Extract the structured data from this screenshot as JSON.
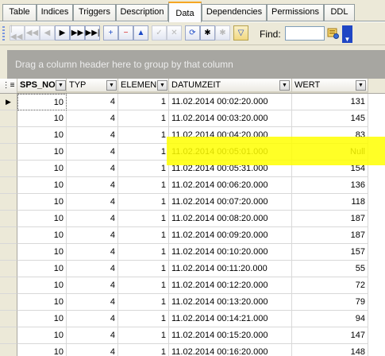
{
  "tabs": [
    {
      "label": "Table"
    },
    {
      "label": "Indices"
    },
    {
      "label": "Triggers"
    },
    {
      "label": "Description"
    },
    {
      "label": "Data"
    },
    {
      "label": "Dependencies"
    },
    {
      "label": "Permissions"
    },
    {
      "label": "DDL"
    }
  ],
  "active_tab": "Data",
  "toolbar": {
    "buttons": [
      {
        "name": "first-record-button",
        "glyph": "|◀◀",
        "state": "disabled"
      },
      {
        "name": "prior-page-button",
        "glyph": "◀◀",
        "state": "disabled"
      },
      {
        "name": "prior-record-button",
        "glyph": "◀",
        "state": "disabled"
      },
      {
        "name": "next-record-button",
        "glyph": "▶",
        "state": "enabled"
      },
      {
        "name": "next-page-button",
        "glyph": "▶▶",
        "state": "enabled"
      },
      {
        "name": "last-record-button",
        "glyph": "▶▶|",
        "state": "enabled"
      },
      {
        "name": "insert-record-button",
        "glyph": "+",
        "state": "enabled"
      },
      {
        "name": "delete-record-button",
        "glyph": "−",
        "state": "enabled"
      },
      {
        "name": "edit-record-button",
        "glyph": "▲",
        "state": "enabled"
      },
      {
        "name": "post-edit-button",
        "glyph": "✓",
        "state": "disabled"
      },
      {
        "name": "cancel-edit-button",
        "glyph": "✕",
        "state": "disabled"
      },
      {
        "name": "refresh-button",
        "glyph": "⟳",
        "state": "enabled"
      },
      {
        "name": "bookmark-button",
        "glyph": "✱",
        "state": "enabled"
      },
      {
        "name": "goto-bookmark-button",
        "glyph": "✱",
        "state": "disabled"
      },
      {
        "name": "filter-button",
        "glyph": "▽",
        "state": "active"
      }
    ],
    "find_label": "Find:",
    "find_value": "",
    "find_placeholder": ""
  },
  "group_panel_text": "Drag a column header here to group by that column",
  "columns": [
    "SPS_NO",
    "TYP",
    "ELEMEN",
    "DATUMZEIT",
    "WERT"
  ],
  "rows": [
    {
      "sps_no": "10",
      "typ": "4",
      "element": "1",
      "datumzeit": "11.02.2014 00:02:20.000",
      "wert": "131"
    },
    {
      "sps_no": "10",
      "typ": "4",
      "element": "1",
      "datumzeit": "11.02.2014 00:03:20.000",
      "wert": "145"
    },
    {
      "sps_no": "10",
      "typ": "4",
      "element": "1",
      "datumzeit": "11.02.2014 00:04:20.000",
      "wert": "83"
    },
    {
      "sps_no": "10",
      "typ": "4",
      "element": "1",
      "datumzeit": "11.02.2014 00:05:01.000",
      "wert": "Null"
    },
    {
      "sps_no": "10",
      "typ": "4",
      "element": "1",
      "datumzeit": "11.02.2014 00:05:31.000",
      "wert": "154"
    },
    {
      "sps_no": "10",
      "typ": "4",
      "element": "1",
      "datumzeit": "11.02.2014 00:06:20.000",
      "wert": "136"
    },
    {
      "sps_no": "10",
      "typ": "4",
      "element": "1",
      "datumzeit": "11.02.2014 00:07:20.000",
      "wert": "118"
    },
    {
      "sps_no": "10",
      "typ": "4",
      "element": "1",
      "datumzeit": "11.02.2014 00:08:20.000",
      "wert": "187"
    },
    {
      "sps_no": "10",
      "typ": "4",
      "element": "1",
      "datumzeit": "11.02.2014 00:09:20.000",
      "wert": "187"
    },
    {
      "sps_no": "10",
      "typ": "4",
      "element": "1",
      "datumzeit": "11.02.2014 00:10:20.000",
      "wert": "157"
    },
    {
      "sps_no": "10",
      "typ": "4",
      "element": "1",
      "datumzeit": "11.02.2014 00:11:20.000",
      "wert": "55"
    },
    {
      "sps_no": "10",
      "typ": "4",
      "element": "1",
      "datumzeit": "11.02.2014 00:12:20.000",
      "wert": "72"
    },
    {
      "sps_no": "10",
      "typ": "4",
      "element": "1",
      "datumzeit": "11.02.2014 00:13:20.000",
      "wert": "79"
    },
    {
      "sps_no": "10",
      "typ": "4",
      "element": "1",
      "datumzeit": "11.02.2014 00:14:21.000",
      "wert": "94"
    },
    {
      "sps_no": "10",
      "typ": "4",
      "element": "1",
      "datumzeit": "11.02.2014 00:15:20.000",
      "wert": "147"
    },
    {
      "sps_no": "10",
      "typ": "4",
      "element": "1",
      "datumzeit": "11.02.2014 00:16:20.000",
      "wert": "148"
    }
  ],
  "colors": {
    "highlight": "#ffff00",
    "tab_active_accent": "#f5a623",
    "window_face": "#ece9d8",
    "group_panel": "#a7a6a1"
  }
}
